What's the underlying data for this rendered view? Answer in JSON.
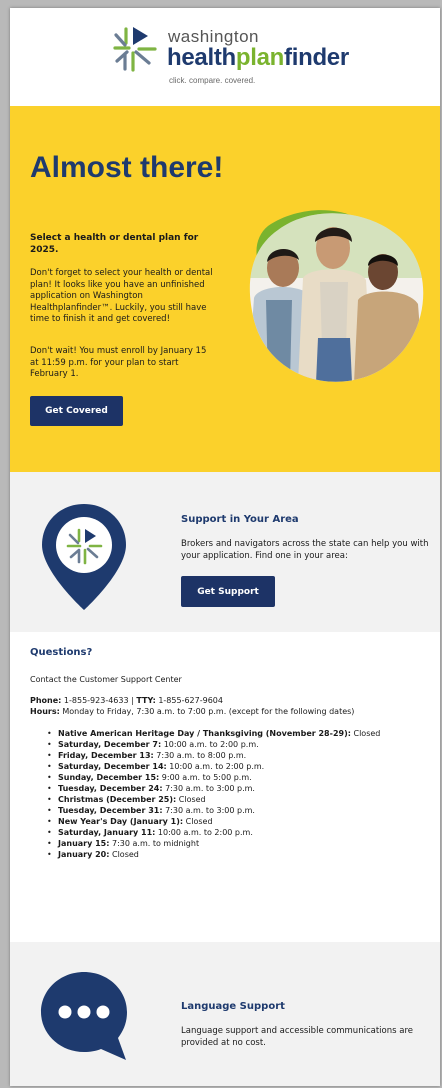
{
  "brand": {
    "small": "washington",
    "big_part1": "health",
    "big_part2": "plan",
    "big_part3": "finder",
    "tagline": "click. compare. covered."
  },
  "hero": {
    "title": "Almost there!",
    "subtitle": "Select a health or dental plan for 2025.",
    "paragraph1": "Don't forget to select your health or dental plan! It looks like you have an unfinished application on Washington Healthplanfinder™. Luckily, you still have time to finish it and get covered!",
    "paragraph2": "Don't wait! You must enroll by January 15 at 11:59 p.m. for your plan to start February 1.",
    "button": "Get Covered"
  },
  "support": {
    "title": "Support in Your Area",
    "text": "Brokers and navigators across the state can help you with your application. Find one in your area:",
    "button": "Get Support"
  },
  "questions": {
    "title": "Questions?",
    "contact": "Contact the Customer Support Center",
    "phone_label": "Phone:",
    "phone": "1-855-923-4633",
    "separator": "|",
    "tty_label": "TTY:",
    "tty": "1-855-627-9604",
    "hours_label": "Hours:",
    "hours": "Monday to Friday, 7:30 a.m. to 7:00 p.m. (except for the following dates)",
    "dates": [
      {
        "label": "Native American Heritage Day / Thanksgiving (November 28-29):",
        "value": "Closed"
      },
      {
        "label": "Saturday, December 7:",
        "value": "10:00 a.m. to 2:00 p.m."
      },
      {
        "label": "Friday, December 13:",
        "value": "7:30 a.m. to 8:00 p.m."
      },
      {
        "label": "Saturday, December 14:",
        "value": "10:00 a.m. to 2:00 p.m."
      },
      {
        "label": "Sunday, December 15:",
        "value": "9:00 a.m. to 5:00 p.m."
      },
      {
        "label": "Tuesday, December 24:",
        "value": "7:30 a.m. to 3:00 p.m."
      },
      {
        "label": "Christmas (December 25):",
        "value": "Closed"
      },
      {
        "label": "Tuesday, December 31:",
        "value": "7:30 a.m. to 3:00 p.m."
      },
      {
        "label": "New Year's Day (January 1):",
        "value": "Closed"
      },
      {
        "label": "Saturday, January 11:",
        "value": "10:00 a.m. to 2:00 p.m."
      },
      {
        "label": "January 15:",
        "value": "7:30 a.m. to midnight"
      },
      {
        "label": "January 20:",
        "value": "Closed"
      }
    ]
  },
  "language": {
    "title": "Language Support",
    "text": "Language support and accessible communications are provided at no cost."
  },
  "colors": {
    "navy": "#1e3a6e",
    "button_navy": "#1d3366",
    "yellow": "#fbd12b",
    "green": "#7ab32e",
    "panel_gray": "#f2f2f2"
  },
  "icons": [
    "logo-mark-icon",
    "location-pin-icon",
    "chat-bubble-icon"
  ]
}
